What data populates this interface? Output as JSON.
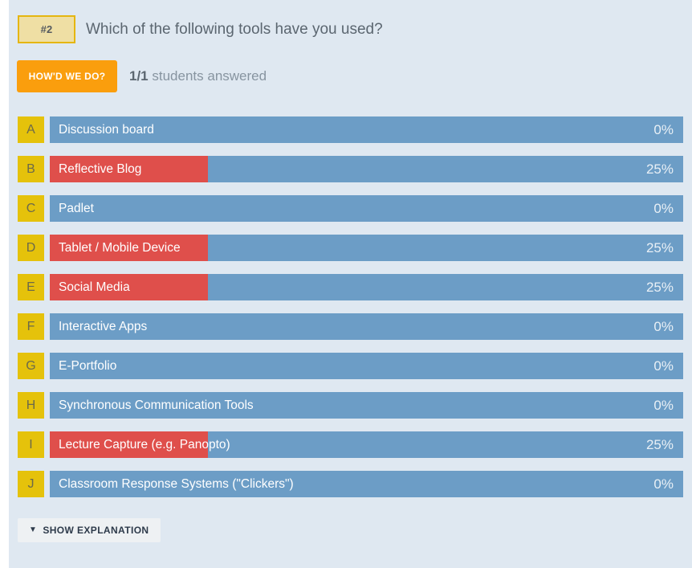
{
  "poll": {
    "question_number": "#2",
    "question_text": "Which of the following tools have you used?",
    "howd_we_do_label": "HOW'D WE DO?",
    "answered_count": "1/1",
    "answered_text": "students answered",
    "show_explanation_label": "SHOW EXPLANATION",
    "caret_glyph": "▼"
  },
  "colors": {
    "card_background": "#dfe8f1",
    "bar_track": "#6c9dc6",
    "bar_fill": "#df4f4b",
    "letter_box": "#e5c20b",
    "badge_background": "#efdfa4",
    "badge_border": "#e5b611",
    "accent_orange": "#fa9e0d",
    "question_text": "#5b6670"
  },
  "chart_data": {
    "type": "bar",
    "title": "Which of the following tools have you used?",
    "xlabel": "",
    "ylabel": "",
    "xlim": [
      0,
      100
    ],
    "unit": "%",
    "grid": false,
    "legend": "none",
    "orientation": "horizontal",
    "max_bar_percent": 100,
    "categories": [
      "Discussion board",
      "Reflective Blog",
      "Padlet",
      "Tablet / Mobile Device",
      "Social Media",
      "Interactive Apps",
      "E-Portfolio",
      "Synchronous Communication Tools",
      "Lecture Capture (e.g. Panopto)",
      "Classroom Response Systems (\"Clickers\")"
    ],
    "letters": [
      "A",
      "B",
      "C",
      "D",
      "E",
      "F",
      "G",
      "H",
      "I",
      "J"
    ],
    "values": [
      0,
      25,
      0,
      25,
      25,
      0,
      0,
      0,
      25,
      0
    ],
    "value_labels": [
      "0%",
      "25%",
      "0%",
      "25%",
      "25%",
      "0%",
      "0%",
      "0%",
      "25%",
      "0%"
    ]
  },
  "rows": [
    {
      "letter": "A",
      "label": "Discussion board",
      "pct": "0%",
      "value": 0
    },
    {
      "letter": "B",
      "label": "Reflective Blog",
      "pct": "25%",
      "value": 25
    },
    {
      "letter": "C",
      "label": "Padlet",
      "pct": "0%",
      "value": 0
    },
    {
      "letter": "D",
      "label": "Tablet / Mobile Device",
      "pct": "25%",
      "value": 25
    },
    {
      "letter": "E",
      "label": "Social Media",
      "pct": "25%",
      "value": 25
    },
    {
      "letter": "F",
      "label": "Interactive Apps",
      "pct": "0%",
      "value": 0
    },
    {
      "letter": "G",
      "label": "E-Portfolio",
      "pct": "0%",
      "value": 0
    },
    {
      "letter": "H",
      "label": "Synchronous Communication Tools",
      "pct": "0%",
      "value": 0
    },
    {
      "letter": "I",
      "label": "Lecture Capture (e.g. Panopto)",
      "pct": "25%",
      "value": 25
    },
    {
      "letter": "J",
      "label": "Classroom Response Systems (\"Clickers\")",
      "pct": "0%",
      "value": 0
    }
  ]
}
